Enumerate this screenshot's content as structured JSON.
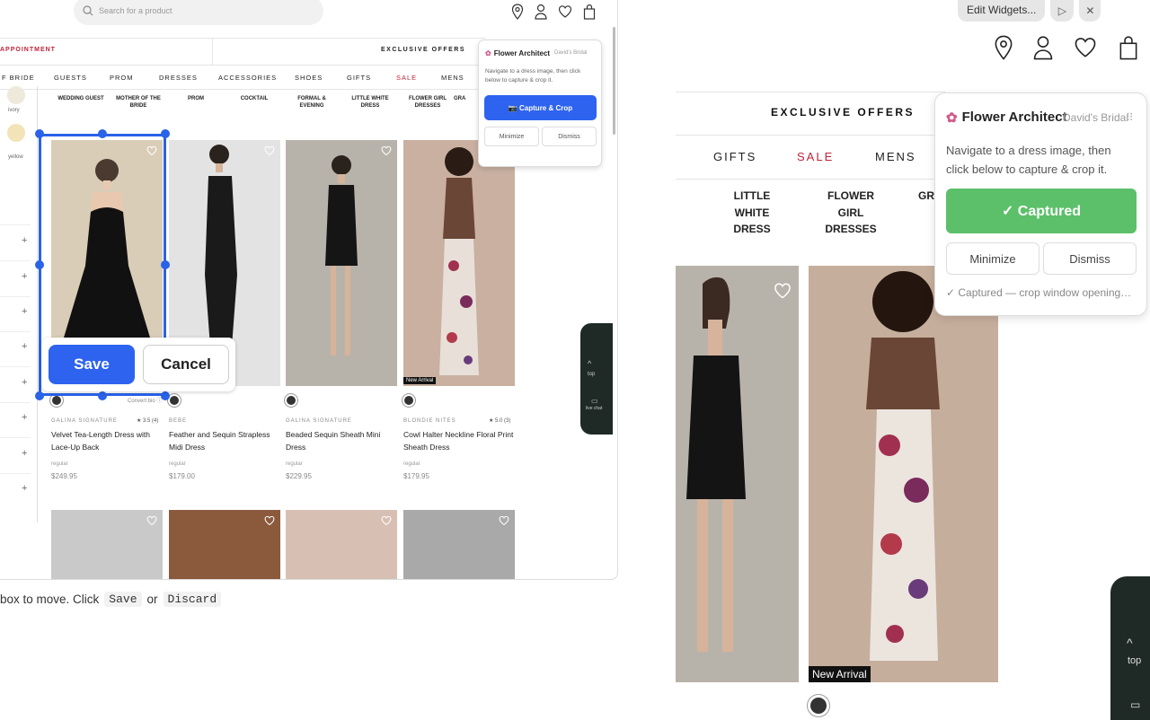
{
  "left": {
    "search_placeholder": "Search for a product",
    "appointment": "APPOINTMENT",
    "exclusive_offers": "EXCLUSIVE OFFERS",
    "nav": [
      "F BRIDE",
      "GUESTS",
      "PROM",
      "DRESSES",
      "ACCESSORIES",
      "SHOES",
      "GIFTS",
      "SALE",
      "MENS"
    ],
    "subcats": [
      "WEDDING GUEST",
      "MOTHER OF THE BRIDE",
      "PROM",
      "COCKTAIL",
      "FORMAL & EVENING",
      "LITTLE WHITE DRESS",
      "FLOWER GIRL DRESSES",
      "GRA"
    ],
    "swatches": [
      {
        "label": "ivory",
        "color": "#efe9dc"
      },
      {
        "label": "yellow",
        "color": "#f2e4b8"
      }
    ],
    "products": [
      {
        "brand": "GALINA SIGNATURE",
        "rating": "★ 3.5 (4)",
        "name": "Velvet Tea-Length Dress with Lace-Up Back",
        "regular": "regular",
        "price": "$249.95",
        "bg": "#d9cdb7"
      },
      {
        "brand": "BEBE",
        "rating": "",
        "name": "Feather and Sequin Strapless Midi Dress",
        "regular": "regular",
        "price": "$179.00",
        "bg": "#e3e3e3"
      },
      {
        "brand": "GALINA SIGNATURE",
        "rating": "",
        "name": "Beaded Sequin Sheath Mini Dress",
        "regular": "regular",
        "price": "$229.95",
        "bg": "#b8b3aa"
      },
      {
        "brand": "BLONDIE NITES",
        "rating": "★ 5.0 (3)",
        "name": "Cowl Halter Neckline Floral Print Sheath Dress",
        "regular": "regular",
        "price": "$179.95",
        "bg": "#c9b0a0"
      }
    ],
    "new_arrival": "New Arrival",
    "compare_label": "Convert bio ⓘ",
    "save_label": "Save",
    "cancel_label": "Cancel",
    "hint_pre": "box to move. Click",
    "hint_save": "Save",
    "hint_or": "or",
    "hint_discard": "Discard",
    "chat_top": "top",
    "chat_live": "live chat",
    "widget": {
      "title": "Flower Architect",
      "site": "David's Bridal",
      "desc": "Navigate to a dress image, then click below to capture & crop it.",
      "primary": "📷 Capture & Crop",
      "minimize": "Minimize",
      "dismiss": "Dismiss"
    }
  },
  "right": {
    "edit_widgets": "Edit Widgets...",
    "exclusive_offers": "EXCLUSIVE OFFERS",
    "nav": [
      "GIFTS",
      "SALE",
      "MENS"
    ],
    "subcats": [
      "LITTLE WHITE DRESS",
      "FLOWER GIRL DRESSES",
      "GRA"
    ],
    "new_arrival": "New Arrival",
    "chat_top": "top",
    "widget": {
      "title": "Flower Architect",
      "site": "David's Bridal",
      "desc": "Navigate to a dress image, then click below to capture & crop it.",
      "primary": "✓ Captured",
      "minimize": "Minimize",
      "dismiss": "Dismiss",
      "status": "✓ Captured — crop window opening…"
    }
  },
  "colors": {
    "accent_blue": "#2d63ee",
    "success_green": "#5cc06a",
    "sale_red": "#c0243a"
  }
}
